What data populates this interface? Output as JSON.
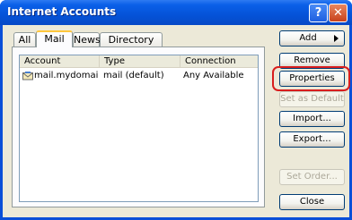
{
  "window": {
    "title": "Internet Accounts",
    "help_glyph": "?",
    "close_glyph": "✕"
  },
  "tabs": [
    {
      "label": "All",
      "active": false
    },
    {
      "label": "Mail",
      "active": true
    },
    {
      "label": "News",
      "active": false
    },
    {
      "label": "Directory Service",
      "active": false
    }
  ],
  "list": {
    "columns": [
      "Account",
      "Type",
      "Connection"
    ],
    "rows": [
      {
        "account": "mail.mydomain.c...",
        "type": "mail (default)",
        "connection": "Any Available",
        "icon": "mail-account-icon"
      }
    ]
  },
  "buttons": {
    "add": "Add",
    "remove": "Remove",
    "properties": "Properties",
    "set_as_default": "Set as Default",
    "import": "Import...",
    "export": "Export...",
    "set_order": "Set Order...",
    "close": "Close"
  },
  "colors": {
    "highlight": "#d81e1e",
    "titlebar": "#0553d8"
  }
}
